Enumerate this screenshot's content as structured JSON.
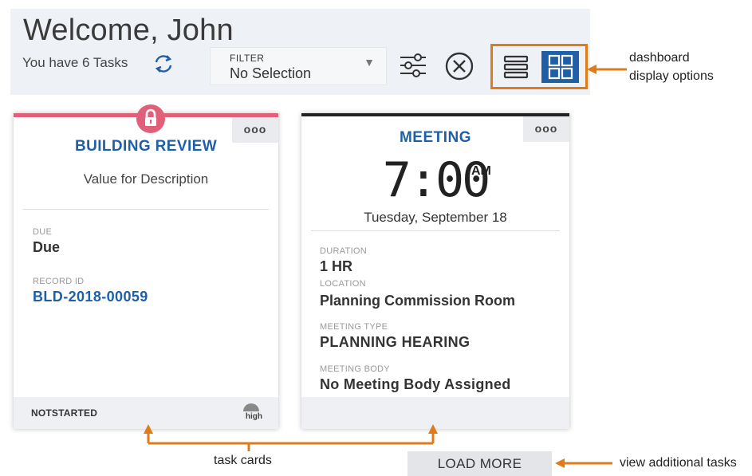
{
  "header": {
    "welcome": "Welcome, John",
    "tasks_count": "You have 6 Tasks",
    "filter_label": "FILTER",
    "filter_value": "No Selection"
  },
  "cards": [
    {
      "title": "BUILDING REVIEW",
      "description": "Value for Description",
      "due_label": "DUE",
      "due_value": "Due",
      "record_label": "RECORD ID",
      "record_value": "BLD-2018-00059",
      "status": "NOTSTARTED",
      "priority": "high",
      "more": "ooo"
    },
    {
      "title": "MEETING",
      "time": "7:00",
      "ampm": "AM",
      "date": "Tuesday, September 18",
      "duration_label": "DURATION",
      "duration_value": "1 HR",
      "location_label": "LOCATION",
      "location_value": "Planning Commission Room",
      "type_label": "MEETING TYPE",
      "type_value": "PLANNING HEARING",
      "body_label": "MEETING BODY",
      "body_value": "No Meeting Body Assigned",
      "more": "ooo"
    }
  ],
  "load_more": "LOAD MORE",
  "annotations": {
    "display_options_line1": "dashboard",
    "display_options_line2": "display options",
    "task_cards": "task cards",
    "view_additional": "view additional tasks"
  },
  "colors": {
    "accent_blue": "#1f5fa8",
    "annotation_orange": "#e07b1a",
    "lock_pink": "#e0607a"
  },
  "icons": [
    "refresh-icon",
    "chevron-down-icon",
    "sliders-icon",
    "close-circle-icon",
    "list-view-icon",
    "grid-view-icon",
    "lock-icon",
    "more-icon",
    "priority-gauge-icon"
  ]
}
